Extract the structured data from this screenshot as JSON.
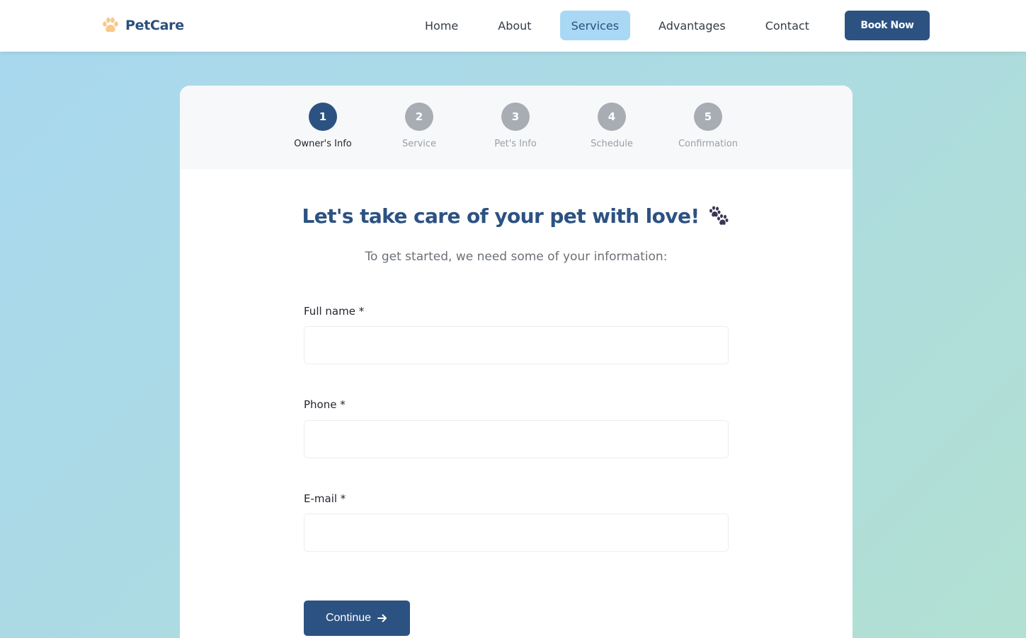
{
  "header": {
    "brand": "PetCare",
    "nav": [
      {
        "label": "Home",
        "active": false
      },
      {
        "label": "About",
        "active": false
      },
      {
        "label": "Services",
        "active": true
      },
      {
        "label": "Advantages",
        "active": false
      },
      {
        "label": "Contact",
        "active": false
      }
    ],
    "cta_label": "Book Now"
  },
  "stepper": {
    "steps": [
      {
        "number": "1",
        "label": "Owner's Info",
        "active": true
      },
      {
        "number": "2",
        "label": "Service",
        "active": false
      },
      {
        "number": "3",
        "label": "Pet's Info",
        "active": false
      },
      {
        "number": "4",
        "label": "Schedule",
        "active": false
      },
      {
        "number": "5",
        "label": "Confirmation",
        "active": false
      }
    ]
  },
  "main": {
    "title": "Let's take care of your pet with love!",
    "subtitle": "To get started, we need some of your information:"
  },
  "form": {
    "fields": [
      {
        "label": "Full name *",
        "value": "",
        "placeholder": ""
      },
      {
        "label": "Phone *",
        "value": "",
        "placeholder": ""
      },
      {
        "label": "E-mail *",
        "value": "",
        "placeholder": ""
      }
    ],
    "continue_label": "Continue"
  },
  "icons": {
    "logo": "paw-icon",
    "title": "paw-prints-icon",
    "continue": "arrow-right-icon"
  },
  "colors": {
    "primary": "#2c5282",
    "nav_active_bg": "#a9d8f5",
    "logo_paw": "#f9c98a",
    "step_inactive": "#a7adb3",
    "title_paw": "#3d3553"
  }
}
